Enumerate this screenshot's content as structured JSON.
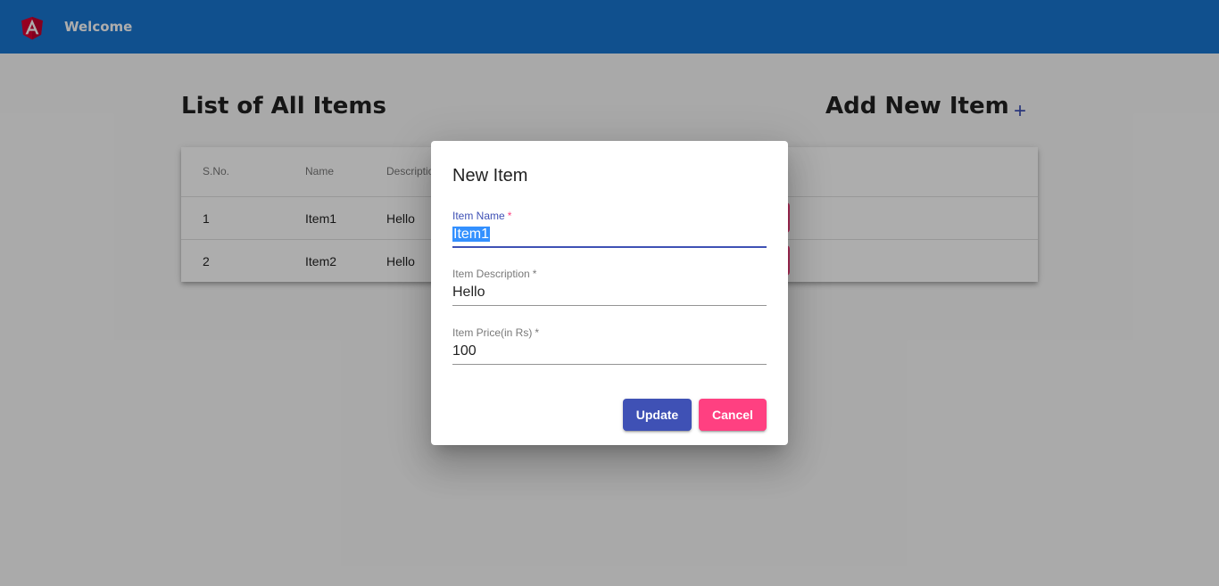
{
  "header": {
    "title": "Welcome",
    "logo_icon": "angular-logo-icon",
    "brand_color": "#1976d2"
  },
  "list": {
    "title": "List of All Items",
    "columns": [
      "S.No.",
      "Name",
      "Description"
    ],
    "rows": [
      {
        "sno": "1",
        "name": "Item1",
        "description": "Hello"
      },
      {
        "sno": "2",
        "name": "Item2",
        "description": "Hello"
      }
    ]
  },
  "add": {
    "title": "Add New Item",
    "icon": "plus-icon"
  },
  "dialog": {
    "title": "New Item",
    "fields": [
      {
        "label": "Item Name",
        "value": "Item1",
        "required": "*"
      },
      {
        "label": "Item Description",
        "value": "Hello",
        "required": "*"
      },
      {
        "label": "Item Price(in Rs)",
        "value": "100",
        "required": "*"
      }
    ],
    "update_label": "Update",
    "cancel_label": "Cancel"
  },
  "colors": {
    "primary": "#3f51b5",
    "accent": "#ff4081",
    "toolbar": "#1976d2"
  }
}
